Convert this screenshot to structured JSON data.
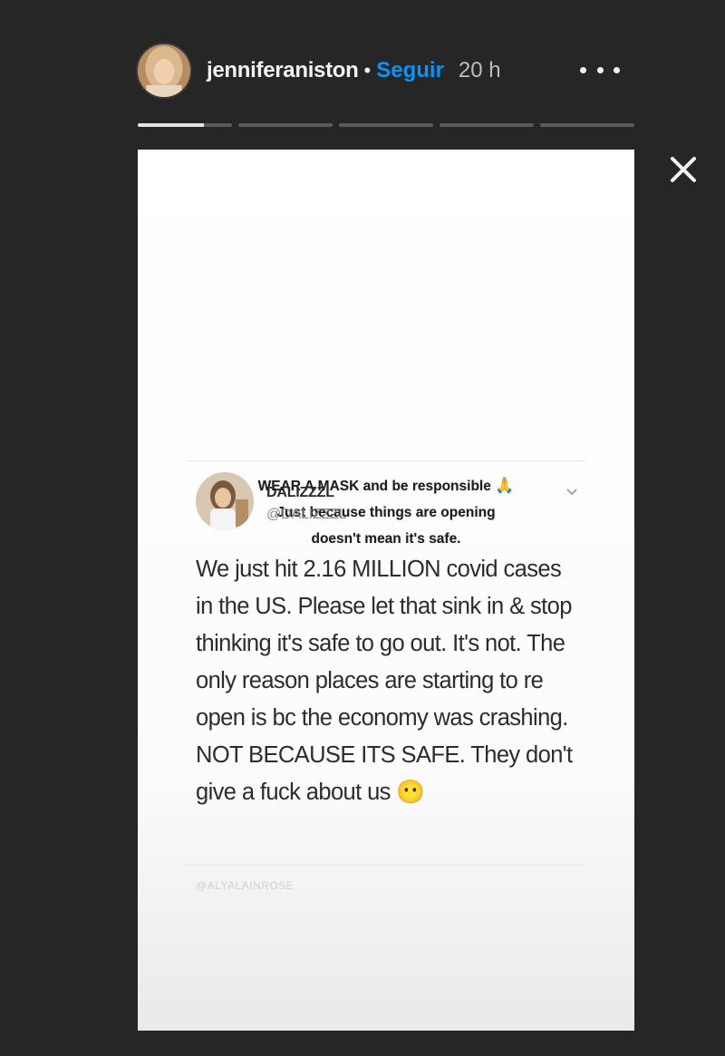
{
  "header": {
    "username": "jenniferaniston",
    "separator": "•",
    "follow_label": "Seguir",
    "time_ago": "20 h"
  },
  "progress": {
    "segments": 5,
    "current_segment_fill": 0.7
  },
  "story": {
    "caption_line1": "WEAR A MASK and be responsible",
    "caption_emoji": "🙏",
    "caption_line2": "Just because things are opening",
    "caption_line3": "doesn't mean it's safe."
  },
  "tweet": {
    "display_name": "DALIZZZL",
    "handle": "@DALIZZZL",
    "body": "We just hit 2.16 MILLION covid cases in the US. Please let that sink in & stop thinking it's safe to go out. It's not. The only reason places are starting to re open is bc the economy was crashing. NOT BECAUSE ITS SAFE. They don't give a fuck about us 😶",
    "footer": "@ALYALAINROSE"
  },
  "colors": {
    "background": "#262626",
    "follow_blue": "#0a95f6",
    "text_light": "#f2f2f2"
  },
  "icons": {
    "more": "more-icon",
    "close": "close-icon",
    "tweet_menu": "chevron-down-icon"
  }
}
